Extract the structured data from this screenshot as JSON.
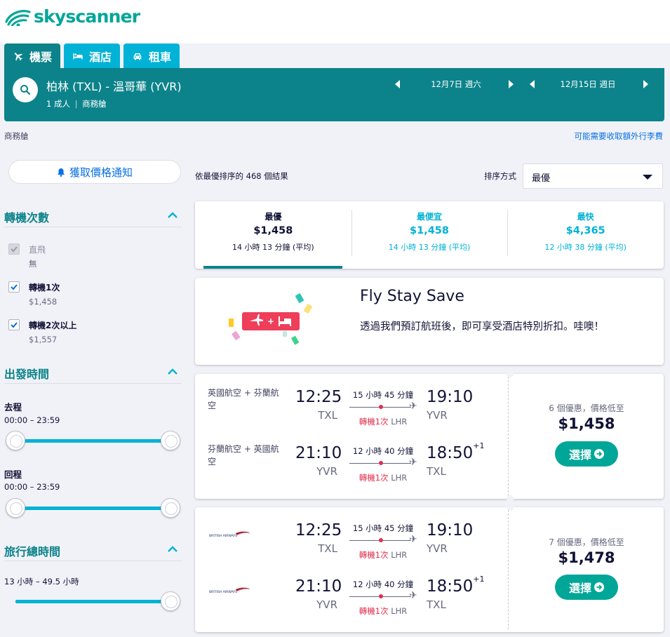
{
  "brand": {
    "name": "skyscanner"
  },
  "tabs": [
    {
      "label": "機票",
      "icon": "plane-icon",
      "active": true
    },
    {
      "label": "酒店",
      "icon": "bed-icon",
      "active": false
    },
    {
      "label": "租車",
      "icon": "car-icon",
      "active": false
    }
  ],
  "search": {
    "route": "柏林 (TXL) - 溫哥華 (YVR)",
    "passengers": "1 成人",
    "cabin": "商務艙",
    "depart_date": "12月7日 週六",
    "return_date": "12月15日 週日"
  },
  "cabin_label": "商務艙",
  "baggage_link": "可能需要收取額外行李費",
  "sidebar": {
    "price_alert": "獲取價格通知",
    "stops": {
      "title": "轉機次數",
      "items": [
        {
          "label": "直飛",
          "sub": "無",
          "checked": true,
          "disabled": true
        },
        {
          "label": "轉機1次",
          "sub": "$1,458",
          "checked": true,
          "disabled": false
        },
        {
          "label": "轉機2次以上",
          "sub": "$1,557",
          "checked": true,
          "disabled": false
        }
      ]
    },
    "departure": {
      "title": "出發時間",
      "outbound_label": "去程",
      "outbound_range": "00:00 – 23:59",
      "return_label": "回程",
      "return_range": "00:00 – 23:59"
    },
    "duration": {
      "title": "旅行總時間",
      "range": "13 小時 – 49.5 小時"
    }
  },
  "results": {
    "count_text": "依最優排序的 468 個結果",
    "sort_label": "排序方式",
    "sort_value": "最優"
  },
  "sort_tabs": [
    {
      "title": "最優",
      "price": "$1,458",
      "duration": "14 小時 13 分鐘 (平均)"
    },
    {
      "title": "最便宜",
      "price": "$1,458",
      "duration": "14 小時 13 分鐘 (平均)"
    },
    {
      "title": "最快",
      "price": "$4,365",
      "duration": "12 小時 38 分鐘 (平均)"
    }
  ],
  "promo": {
    "title": "Fly Stay Save",
    "description": "透過我們預訂航班後，即可享受酒店特別折扣。哇噢！"
  },
  "flights": [
    {
      "legs": [
        {
          "airline": "英國航空 + 芬蘭航空",
          "dep_time": "12:25",
          "dep_airport": "TXL",
          "duration": "15 小時 45 分鐘",
          "stops": "轉機1次",
          "via": "LHR",
          "arr_time": "19:10",
          "arr_airport": "YVR",
          "day_offset": ""
        },
        {
          "airline": "芬蘭航空 + 英國航空",
          "dep_time": "21:10",
          "dep_airport": "YVR",
          "duration": "12 小時 40 分鐘",
          "stops": "轉機1次",
          "via": "LHR",
          "arr_time": "18:50",
          "arr_airport": "TXL",
          "day_offset": "+1"
        }
      ],
      "deals": "6 個優惠，價格低至",
      "price": "$1,458",
      "select_label": "選擇"
    },
    {
      "legs": [
        {
          "airline": "BRITISH AIRWAYS",
          "dep_time": "12:25",
          "dep_airport": "TXL",
          "duration": "15 小時 45 分鐘",
          "stops": "轉機1次",
          "via": "LHR",
          "arr_time": "19:10",
          "arr_airport": "YVR",
          "day_offset": ""
        },
        {
          "airline": "BRITISH AIRWAYS",
          "dep_time": "21:10",
          "dep_airport": "YVR",
          "duration": "12 小時 40 分鐘",
          "stops": "轉機1次",
          "via": "LHR",
          "arr_time": "18:50",
          "arr_airport": "TXL",
          "day_offset": "+1"
        }
      ],
      "deals": "7 個優惠，價格低至",
      "price": "$1,478",
      "select_label": "選擇"
    }
  ],
  "colors": {
    "brand_teal": "#0c838a",
    "accent_blue": "#00b2d6",
    "select_green": "#00a698",
    "stop_red": "#e02f4e"
  }
}
